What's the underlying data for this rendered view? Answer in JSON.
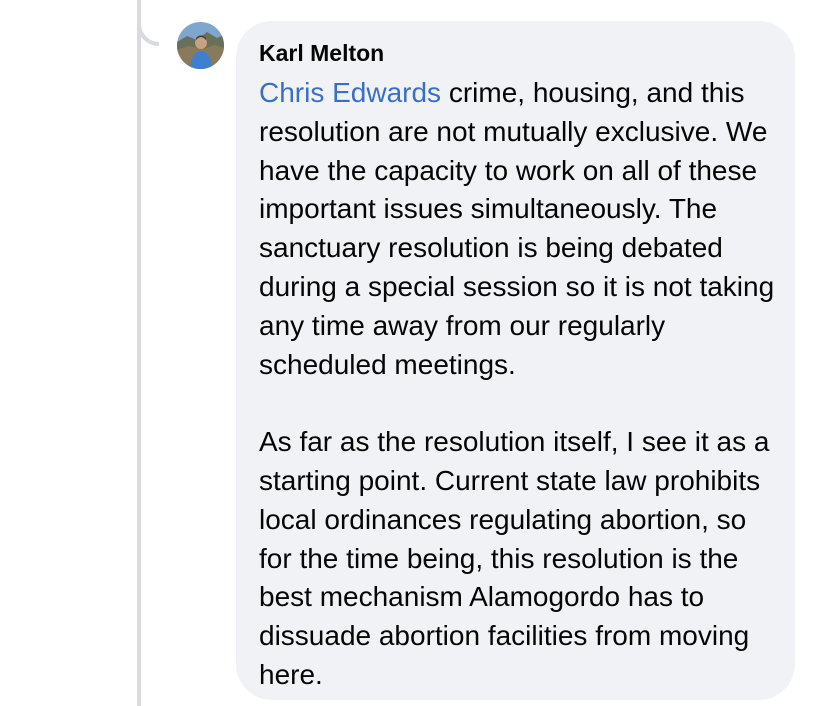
{
  "comment": {
    "author": "Karl Melton",
    "avatar_icon": "profile-photo-avatar",
    "mention": "Chris Edwards",
    "paragraph_1": " crime, housing, and this resolution are not mutually exclusive. We have the capacity to work on all of these important issues simultaneously. The sanctuary resolution is being debated during a special session so it is not taking any time away from our regularly scheduled meetings.",
    "paragraph_2": "As far as the resolution itself, I see it as a starting point. Current state law prohibits local ordinances regulating abortion, so for the time being, this resolution is the best mechanism Alamogordo has to dissuade abortion facilities from moving here."
  },
  "colors": {
    "bubble_background": "#f0f2f5",
    "mention_link": "#3b6fc4",
    "text": "#050505",
    "thread_line": "#d8dadf"
  }
}
